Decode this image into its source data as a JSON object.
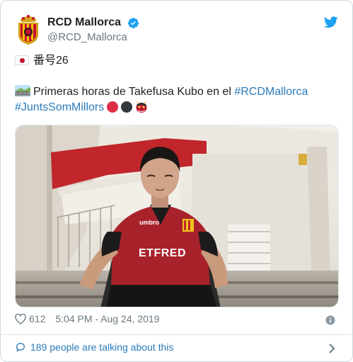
{
  "account": {
    "name": "RCD Mallorca",
    "handle": "@RCD_Mallorca"
  },
  "tweet": {
    "line1_text": "番号26",
    "line2_prefix": "Primeras horas de Takefusa Kubo en el ",
    "hashtag1": "#RCDMallorca",
    "hashtag2": "#JuntsSomMillors",
    "emoji_line1": "japan-flag",
    "emoji_line2": "railway-track",
    "emoji_tail": [
      "red-circle",
      "black-circle",
      "ogre"
    ]
  },
  "media": {
    "jersey_text": "ETFRED"
  },
  "meta": {
    "likes": "612",
    "timestamp": "5:04 PM - Aug 24, 2019"
  },
  "footer": {
    "talking": "189 people are talking about this"
  },
  "colors": {
    "link": "#2b7bb9",
    "muted": "#697882",
    "verified": "#1da1f2"
  }
}
